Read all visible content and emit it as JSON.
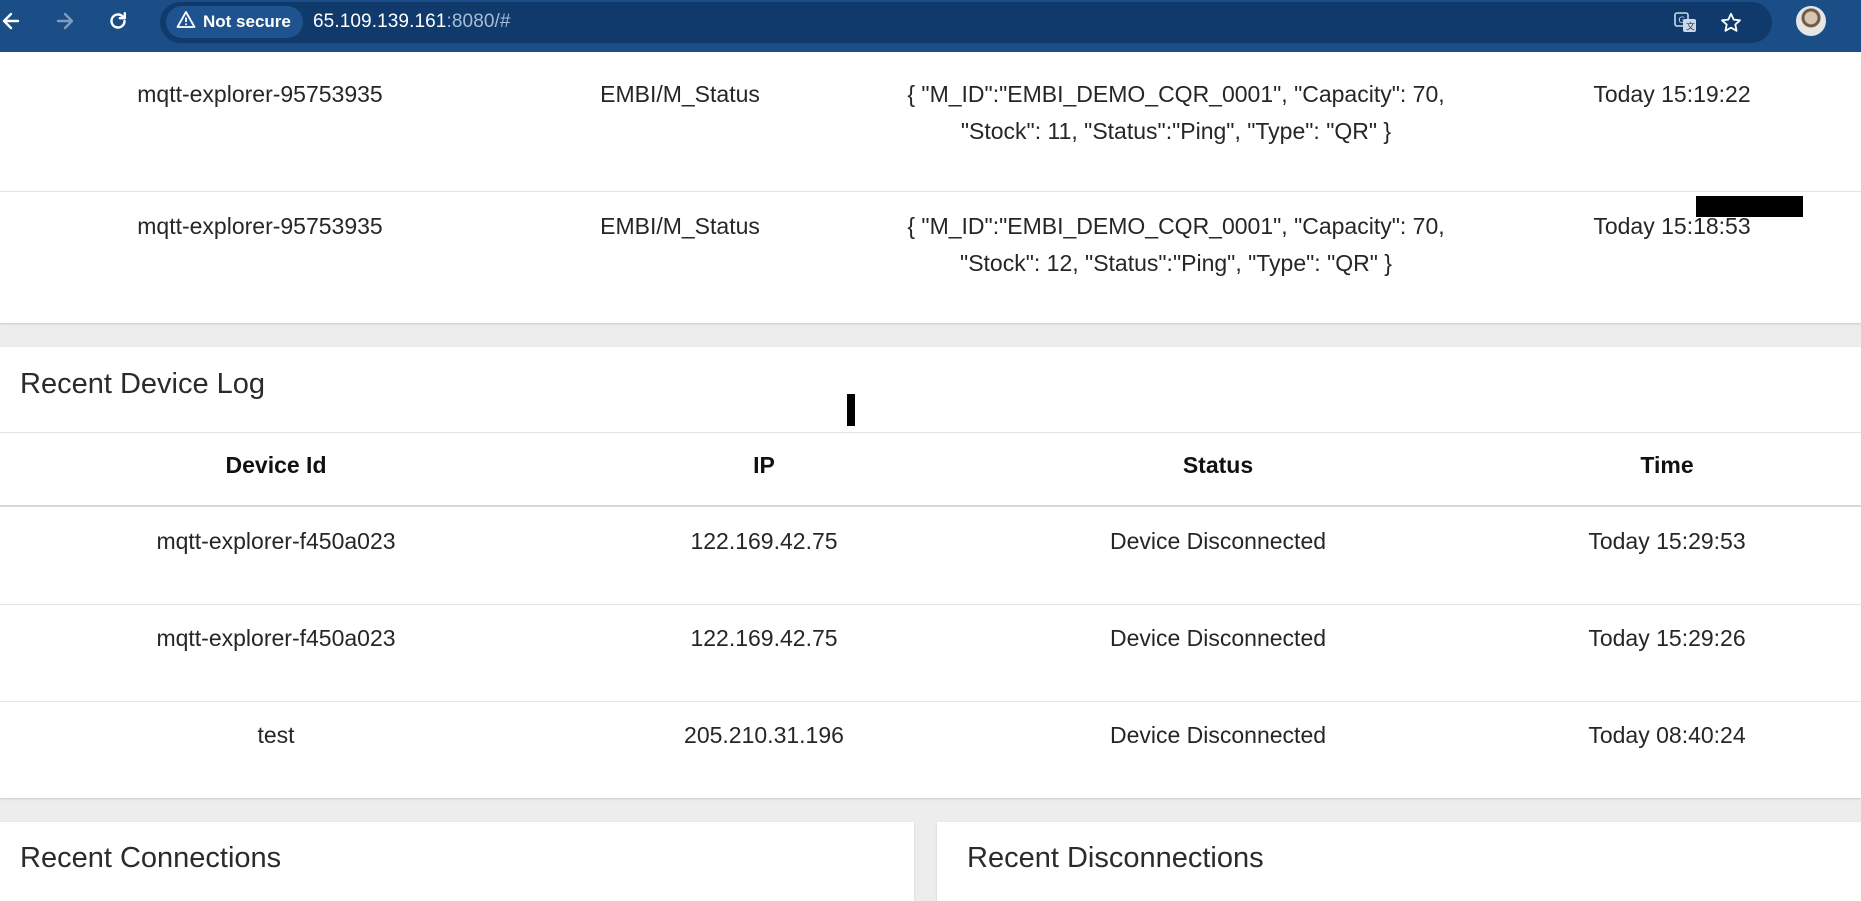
{
  "browser": {
    "security_label": "Not secure",
    "url_host": "65.109.139.161",
    "url_rest": ":8080/#",
    "icons": [
      "back-arrow-icon",
      "forward-arrow-icon",
      "reload-icon",
      "warning-triangle-icon",
      "translate-icon",
      "star-icon",
      "profile-avatar"
    ]
  },
  "messages": {
    "rows": [
      {
        "client": "mqtt-explorer-95753935",
        "topic": "EMBI/M_Status",
        "payload_line1": "{ \"M_ID\":\"EMBI_DEMO_CQR_0001\", \"Capacity\": 70,",
        "payload_line2": "\"Stock\": 11, \"Status\":\"Ping\", \"Type\": \"QR\" }",
        "time": "Today 15:19:22"
      },
      {
        "client": "mqtt-explorer-95753935",
        "topic": "EMBI/M_Status",
        "payload_line1": "{ \"M_ID\":\"EMBI_DEMO_CQR_0001\", \"Capacity\": 70,",
        "payload_line2": "\"Stock\": 12, \"Status\":\"Ping\", \"Type\": \"QR\" }",
        "time": "Today 15:18:53"
      }
    ]
  },
  "device_log": {
    "title": "Recent Device Log",
    "columns": [
      "Device Id",
      "IP",
      "Status",
      "Time"
    ],
    "rows": [
      {
        "device_id": "mqtt-explorer-f450a023",
        "ip": "122.169.42.75",
        "status": "Device Disconnected",
        "time": "Today 15:29:53"
      },
      {
        "device_id": "mqtt-explorer-f450a023",
        "ip": "122.169.42.75",
        "status": "Device Disconnected",
        "time": "Today 15:29:26"
      },
      {
        "device_id": "test",
        "ip": "205.210.31.196",
        "status": "Device Disconnected",
        "time": "Today 08:40:24"
      }
    ]
  },
  "connections": {
    "title": "Recent Connections"
  },
  "disconnections": {
    "title": "Recent Disconnections"
  },
  "colors": {
    "chrome": "#1b4d86",
    "omnibox": "#0f3a6b",
    "page_bg": "#ededed"
  }
}
